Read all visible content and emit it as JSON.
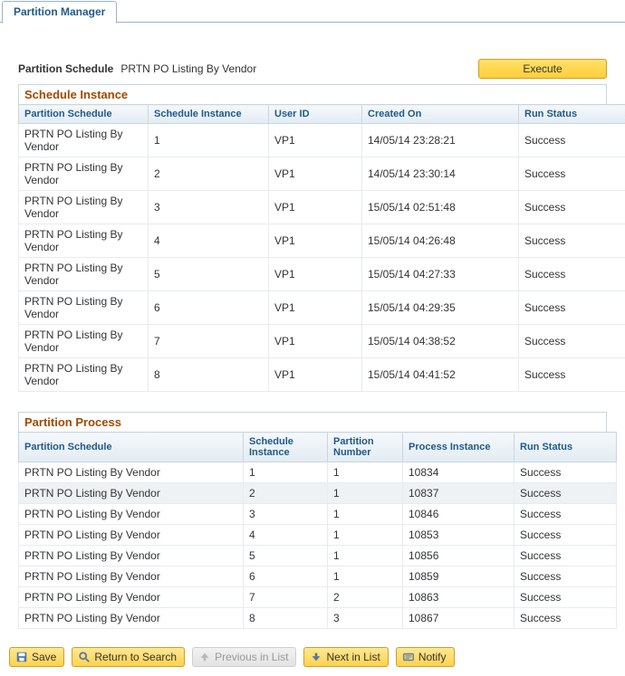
{
  "tab": {
    "label": "Partition Manager"
  },
  "schedule": {
    "label": "Partition Schedule",
    "value": "PRTN PO Listing By Vendor",
    "execute_label": "Execute"
  },
  "instance_section": {
    "title": "Schedule Instance",
    "columns": [
      "Partition Schedule",
      "Schedule Instance",
      "User ID",
      "Created On",
      "Run Status"
    ],
    "rows": [
      {
        "sched": "PRTN PO Listing By Vendor",
        "inst": "1",
        "user": "VP1",
        "created": "14/05/14 23:28:21",
        "status": "Success"
      },
      {
        "sched": "PRTN PO Listing By Vendor",
        "inst": "2",
        "user": "VP1",
        "created": "14/05/14 23:30:14",
        "status": "Success"
      },
      {
        "sched": "PRTN PO Listing By Vendor",
        "inst": "3",
        "user": "VP1",
        "created": "15/05/14 02:51:48",
        "status": "Success"
      },
      {
        "sched": "PRTN PO Listing By Vendor",
        "inst": "4",
        "user": "VP1",
        "created": "15/05/14 04:26:48",
        "status": "Success"
      },
      {
        "sched": "PRTN PO Listing By Vendor",
        "inst": "5",
        "user": "VP1",
        "created": "15/05/14 04:27:33",
        "status": "Success"
      },
      {
        "sched": "PRTN PO Listing By Vendor",
        "inst": "6",
        "user": "VP1",
        "created": "15/05/14 04:29:35",
        "status": "Success"
      },
      {
        "sched": "PRTN PO Listing By Vendor",
        "inst": "7",
        "user": "VP1",
        "created": "15/05/14 04:38:52",
        "status": "Success"
      },
      {
        "sched": "PRTN PO Listing By Vendor",
        "inst": "8",
        "user": "VP1",
        "created": "15/05/14 04:41:52",
        "status": "Success"
      }
    ]
  },
  "process_section": {
    "title": "Partition Process",
    "columns": [
      "Partition Schedule",
      "Schedule Instance",
      "Partition Number",
      "Process Instance",
      "Run Status"
    ],
    "rows": [
      {
        "sched": "PRTN PO Listing By Vendor",
        "sinst": "1",
        "pnum": "1",
        "pinst": "10834",
        "status": "Success"
      },
      {
        "sched": "PRTN PO Listing By Vendor",
        "sinst": "2",
        "pnum": "1",
        "pinst": "10837",
        "status": "Success"
      },
      {
        "sched": "PRTN PO Listing By Vendor",
        "sinst": "3",
        "pnum": "1",
        "pinst": "10846",
        "status": "Success"
      },
      {
        "sched": "PRTN PO Listing By Vendor",
        "sinst": "4",
        "pnum": "1",
        "pinst": "10853",
        "status": "Success"
      },
      {
        "sched": "PRTN PO Listing By Vendor",
        "sinst": "5",
        "pnum": "1",
        "pinst": "10856",
        "status": "Success"
      },
      {
        "sched": "PRTN PO Listing By Vendor",
        "sinst": "6",
        "pnum": "1",
        "pinst": "10859",
        "status": "Success"
      },
      {
        "sched": "PRTN PO Listing By Vendor",
        "sinst": "7",
        "pnum": "2",
        "pinst": "10863",
        "status": "Success"
      },
      {
        "sched": "PRTN PO Listing By Vendor",
        "sinst": "8",
        "pnum": "3",
        "pinst": "10867",
        "status": "Success"
      }
    ]
  },
  "toolbar": {
    "save": "Save",
    "return": "Return to Search",
    "prev": "Previous in List",
    "next": "Next in List",
    "notify": "Notify"
  }
}
